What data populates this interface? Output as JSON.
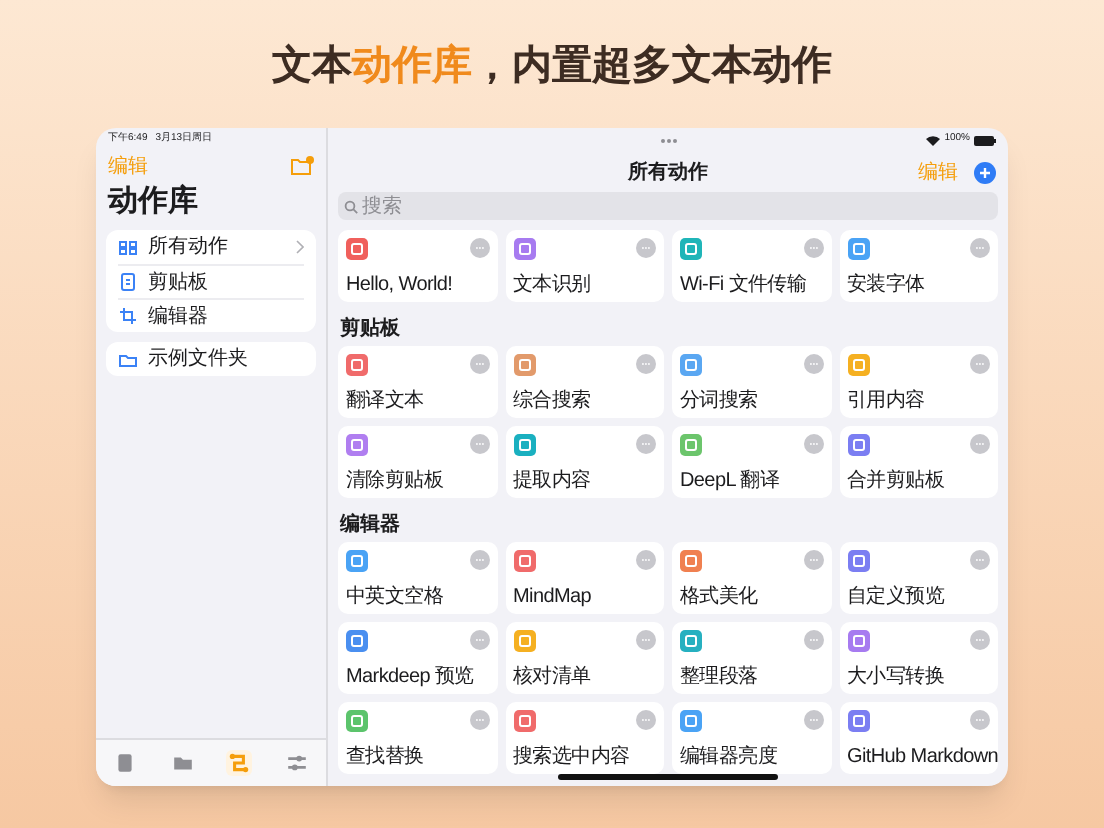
{
  "headline": [
    {
      "text": "文本",
      "highlight": false
    },
    {
      "text": "动作库",
      "highlight": true
    },
    {
      "text": "，内置超多文本动作",
      "highlight": false
    }
  ],
  "status_bar": {
    "time": "下午6:49",
    "date": "3月13日周日",
    "battery": "100%"
  },
  "sidebar": {
    "edit": "编辑",
    "title": "动作库",
    "groups": [
      [
        {
          "label": "所有动作",
          "kind": "grid",
          "chevron": true
        },
        {
          "label": "剪贴板",
          "kind": "clipboard",
          "chevron": false
        },
        {
          "label": "编辑器",
          "kind": "crop",
          "chevron": false
        }
      ],
      [
        {
          "label": "示例文件夹",
          "kind": "folder",
          "chevron": false
        }
      ]
    ]
  },
  "tab_bar": [
    {
      "kind": "clipboard",
      "selected": false
    },
    {
      "kind": "folder",
      "selected": false
    },
    {
      "kind": "flow",
      "selected": true
    },
    {
      "kind": "sliders",
      "selected": false
    }
  ],
  "main": {
    "title": "所有动作",
    "edit": "编辑",
    "search": {
      "placeholder": "搜索"
    },
    "sections": [
      {
        "tiles": [
          {
            "label": "Hello, World!",
            "color": "#f0605c"
          },
          {
            "label": "文本识别",
            "color": "#a77bf0"
          },
          {
            "label": "Wi-Fi 文件传输",
            "color": "#1fb5b8"
          },
          {
            "label": "安装字体",
            "color": "#4aa3f5"
          }
        ]
      },
      {
        "title": "剪贴板",
        "tiles": [
          {
            "label": "翻译文本",
            "color": "#f06b6b"
          },
          {
            "label": "综合搜索",
            "color": "#e29a6b"
          },
          {
            "label": "分词搜索",
            "color": "#5aa7f2"
          },
          {
            "label": "引用内容",
            "color": "#f5b021"
          },
          {
            "label": "清除剪贴板",
            "color": "#b07ef0"
          },
          {
            "label": "提取内容",
            "color": "#1ab0c0"
          },
          {
            "label": "DeepL 翻译",
            "color": "#6cc56c"
          },
          {
            "label": "合并剪贴板",
            "color": "#7b7ef2"
          }
        ]
      },
      {
        "title": "编辑器",
        "tiles": [
          {
            "label": "中英文空格",
            "color": "#4aa3f5"
          },
          {
            "label": "MindMap",
            "color": "#f06b6b"
          },
          {
            "label": "格式美化",
            "color": "#f08050"
          },
          {
            "label": "自定义预览",
            "color": "#7b7ef2"
          },
          {
            "label": "Markdeep 预览",
            "color": "#4a8ff0"
          },
          {
            "label": "核对清单",
            "color": "#f5b021"
          },
          {
            "label": "整理段落",
            "color": "#26b0c0"
          },
          {
            "label": "大小写转换",
            "color": "#a77bf0"
          },
          {
            "label": "查找替换",
            "color": "#5cc46c"
          },
          {
            "label": "搜索选中内容",
            "color": "#f06b6b"
          },
          {
            "label": "编辑器亮度",
            "color": "#4aa3f5"
          },
          {
            "label": "GitHub Markdown",
            "color": "#7b7ef2"
          }
        ]
      }
    ]
  }
}
